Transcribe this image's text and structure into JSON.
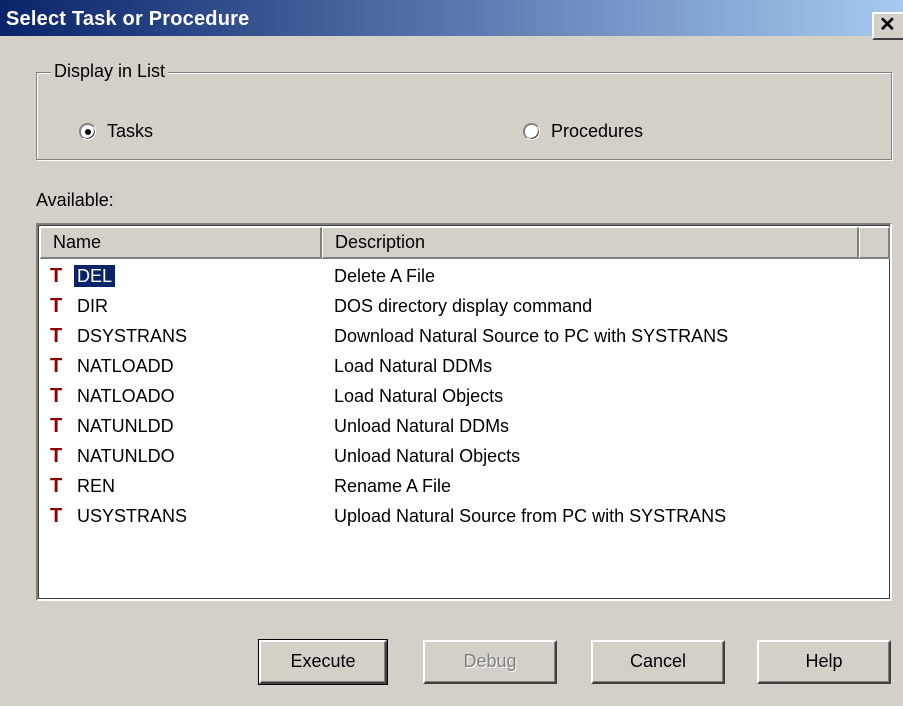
{
  "window": {
    "title": "Select Task or Procedure",
    "close_glyph": "✕"
  },
  "group": {
    "legend": "Display in List",
    "options": [
      {
        "label": "Tasks",
        "selected": true
      },
      {
        "label": "Procedures",
        "selected": false
      }
    ]
  },
  "available_label": "Available:",
  "list": {
    "columns": [
      "Name",
      "Description"
    ],
    "type_icon": "T",
    "rows": [
      {
        "name": "DEL",
        "description": "Delete A File",
        "selected": true
      },
      {
        "name": "DIR",
        "description": "DOS directory display command"
      },
      {
        "name": "DSYSTRANS",
        "description": "Download Natural Source to PC with SYSTRANS"
      },
      {
        "name": "NATLOADD",
        "description": "Load Natural DDMs"
      },
      {
        "name": "NATLOADO",
        "description": "Load Natural Objects"
      },
      {
        "name": "NATUNLDD",
        "description": "Unload Natural DDMs"
      },
      {
        "name": "NATUNLDO",
        "description": "Unload Natural Objects"
      },
      {
        "name": "REN",
        "description": "Rename A File"
      },
      {
        "name": "USYSTRANS",
        "description": "Upload Natural Source from PC with SYSTRANS"
      }
    ]
  },
  "buttons": {
    "execute": "Execute",
    "debug": "Debug",
    "cancel": "Cancel",
    "help": "Help"
  },
  "colors": {
    "title_gradient_start": "#0a246a",
    "title_gradient_end": "#a6caf0",
    "task_icon": "#8b0000",
    "selection": "#0a246a",
    "face": "#d4d0c8"
  }
}
